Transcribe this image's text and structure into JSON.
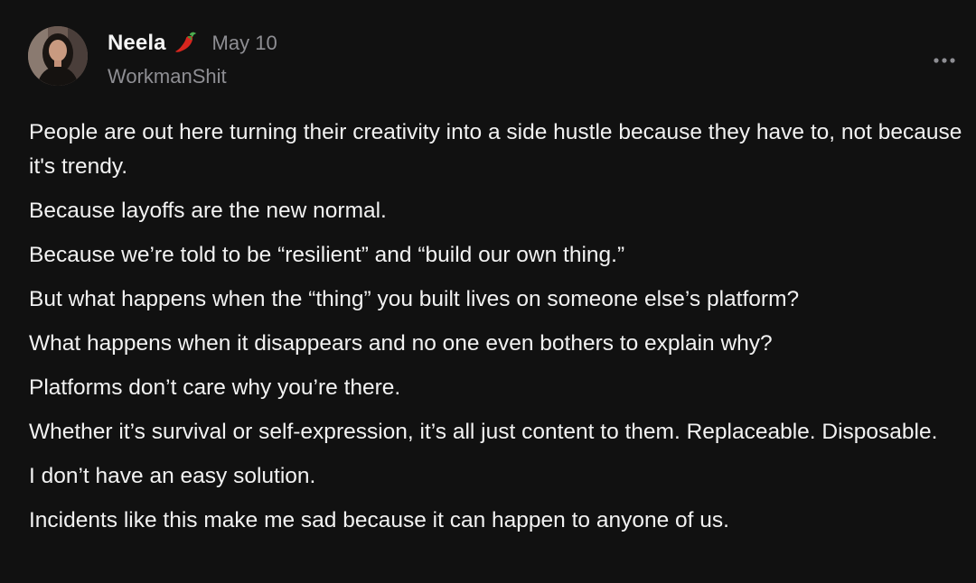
{
  "post": {
    "author": {
      "name": "Neela",
      "badge_icon": "chili-pepper-icon",
      "handle": "WorkmanShit"
    },
    "date": "May 10",
    "menu_icon": "more-options-icon",
    "paragraphs": [
      "People are out here turning their creativity into a side hustle because they have to, not because it's trendy.",
      "Because layoffs are the new normal.",
      "Because we’re told to be “resilient” and “build our own thing.”",
      "But what happens when the “thing” you built lives on someone else’s platform?",
      "What happens when it disappears and no one even bothers to explain why?",
      "Platforms don’t care why you’re there.",
      "Whether it’s survival or self-expression, it’s all just content to them. Replaceable. Disposable.",
      "I don’t have an easy solution.",
      "Incidents like this make me sad because it can happen to anyone of us."
    ]
  },
  "colors": {
    "background": "#111111",
    "text_primary": "#f2f2f2",
    "text_secondary": "#8e8e93",
    "pepper_red": "#d7261e"
  }
}
